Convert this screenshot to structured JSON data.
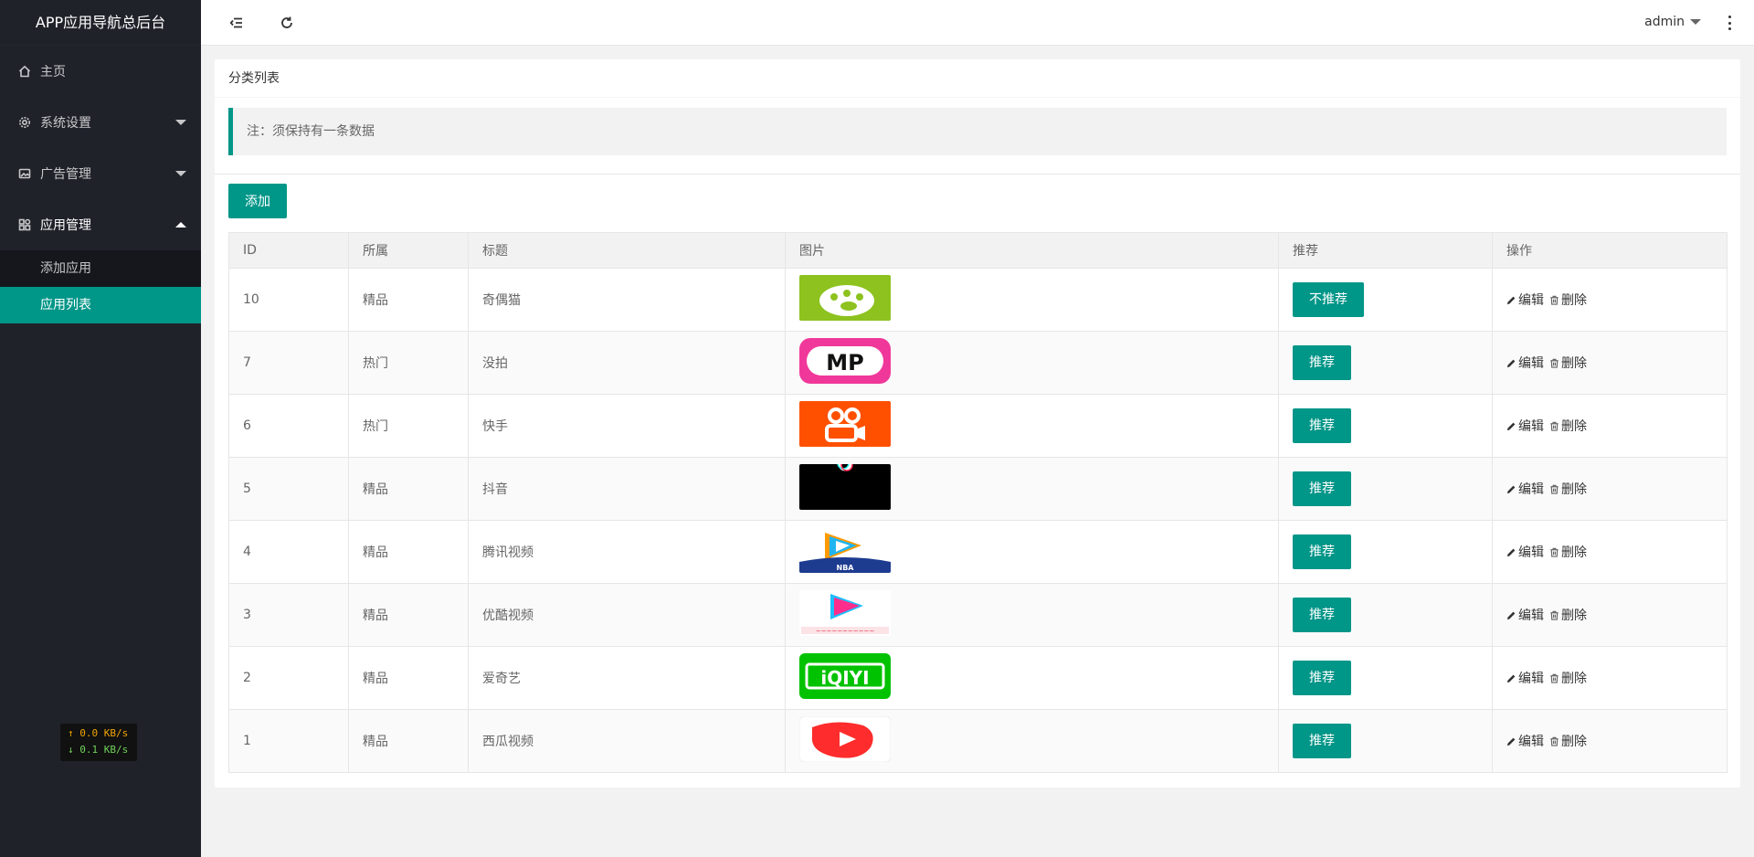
{
  "app": {
    "title": "APP应用导航总后台"
  },
  "sidebar": {
    "items": [
      {
        "label": "主页",
        "icon": "home-icon"
      },
      {
        "label": "系统设置",
        "icon": "gear-icon"
      },
      {
        "label": "广告管理",
        "icon": "image-icon"
      },
      {
        "label": "应用管理",
        "icon": "apps-icon"
      }
    ],
    "subitems": [
      {
        "label": "添加应用"
      },
      {
        "label": "应用列表",
        "active": true
      }
    ]
  },
  "netspeed": {
    "up": "↑ 0.0 KB/s",
    "down": "↓ 0.1 KB/s"
  },
  "header": {
    "user": "admin",
    "flexible_icon": "menu-collapse-icon",
    "refresh_icon": "refresh-icon",
    "more_icon": "more-vertical-icon"
  },
  "card": {
    "title": "分类列表",
    "note": "注：须保持有一条数据",
    "add_label": "添加"
  },
  "table": {
    "headers": [
      "ID",
      "所属",
      "标题",
      "图片",
      "推荐",
      "操作"
    ],
    "edit_label": "编辑",
    "delete_label": "删除",
    "rows": [
      {
        "id": "10",
        "category": "精品",
        "title": "奇偶猫",
        "image": "qiou-cat-logo",
        "recommend": "不推荐"
      },
      {
        "id": "7",
        "category": "热门",
        "title": "没拍",
        "image": "mp-logo",
        "recommend": "推荐"
      },
      {
        "id": "6",
        "category": "热门",
        "title": "快手",
        "image": "kuaishou-logo",
        "recommend": "推荐"
      },
      {
        "id": "5",
        "category": "精品",
        "title": "抖音",
        "image": "douyin-logo",
        "recommend": "推荐"
      },
      {
        "id": "4",
        "category": "精品",
        "title": "腾讯视频",
        "image": "tencent-video-logo",
        "recommend": "推荐"
      },
      {
        "id": "3",
        "category": "精品",
        "title": "优酷视频",
        "image": "youku-logo",
        "recommend": "推荐"
      },
      {
        "id": "2",
        "category": "精品",
        "title": "爱奇艺",
        "image": "iqiyi-logo",
        "recommend": "推荐"
      },
      {
        "id": "1",
        "category": "精品",
        "title": "西瓜视频",
        "image": "xigua-logo",
        "recommend": "推荐"
      }
    ]
  },
  "colors": {
    "accent": "#009688",
    "sidebar_bg": "#20222a"
  }
}
